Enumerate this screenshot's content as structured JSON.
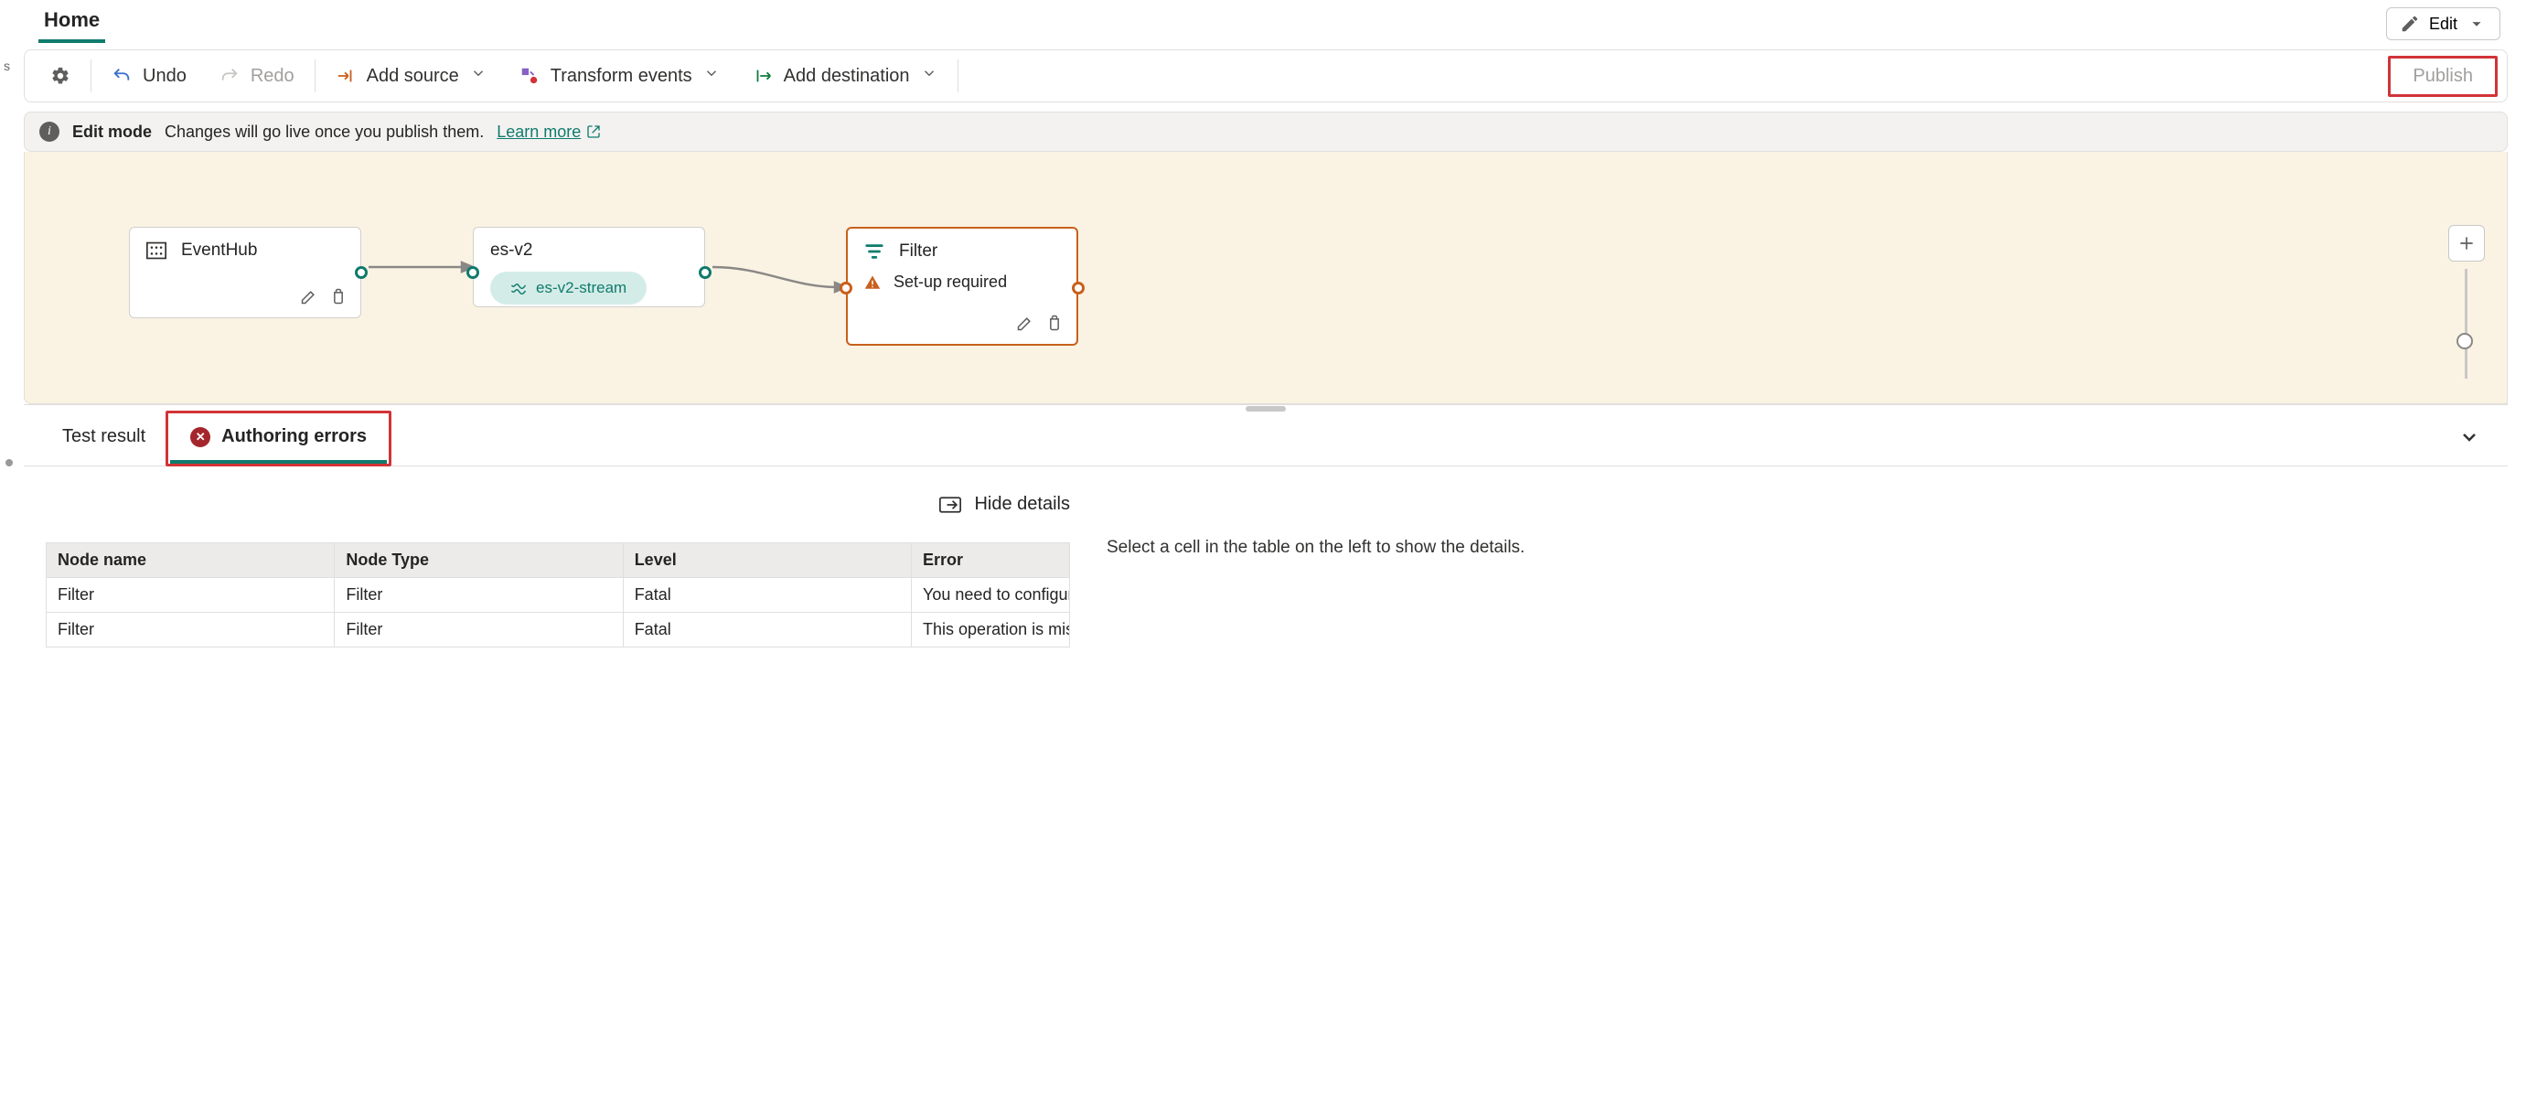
{
  "header": {
    "home_tab": "Home",
    "edit_button": "Edit"
  },
  "toolbar": {
    "undo": "Undo",
    "redo": "Redo",
    "add_source": "Add source",
    "transform": "Transform events",
    "add_destination": "Add destination",
    "publish": "Publish"
  },
  "info_bar": {
    "title": "Edit mode",
    "message": "Changes will go live once you publish them.",
    "learn_more": "Learn more"
  },
  "canvas": {
    "node_eventhub": {
      "title": "EventHub"
    },
    "node_esv2": {
      "title": "es-v2",
      "stream_pill": "es-v2-stream"
    },
    "node_filter": {
      "title": "Filter",
      "warning": "Set-up required"
    }
  },
  "bottom_tabs": {
    "test_result": "Test result",
    "authoring_errors": "Authoring errors"
  },
  "errors": {
    "hide_details": "Hide details",
    "columns": {
      "name": "Node name",
      "type": "Node Type",
      "level": "Level",
      "error": "Error"
    },
    "rows": [
      {
        "name": "Filter",
        "type": "Filter",
        "level": "Fatal",
        "error": "You need to configure t"
      },
      {
        "name": "Filter",
        "type": "Filter",
        "level": "Fatal",
        "error": "This operation is missin"
      }
    ],
    "detail_placeholder": "Select a cell in the table on the left to show the details."
  },
  "sidebar_hint": "s"
}
